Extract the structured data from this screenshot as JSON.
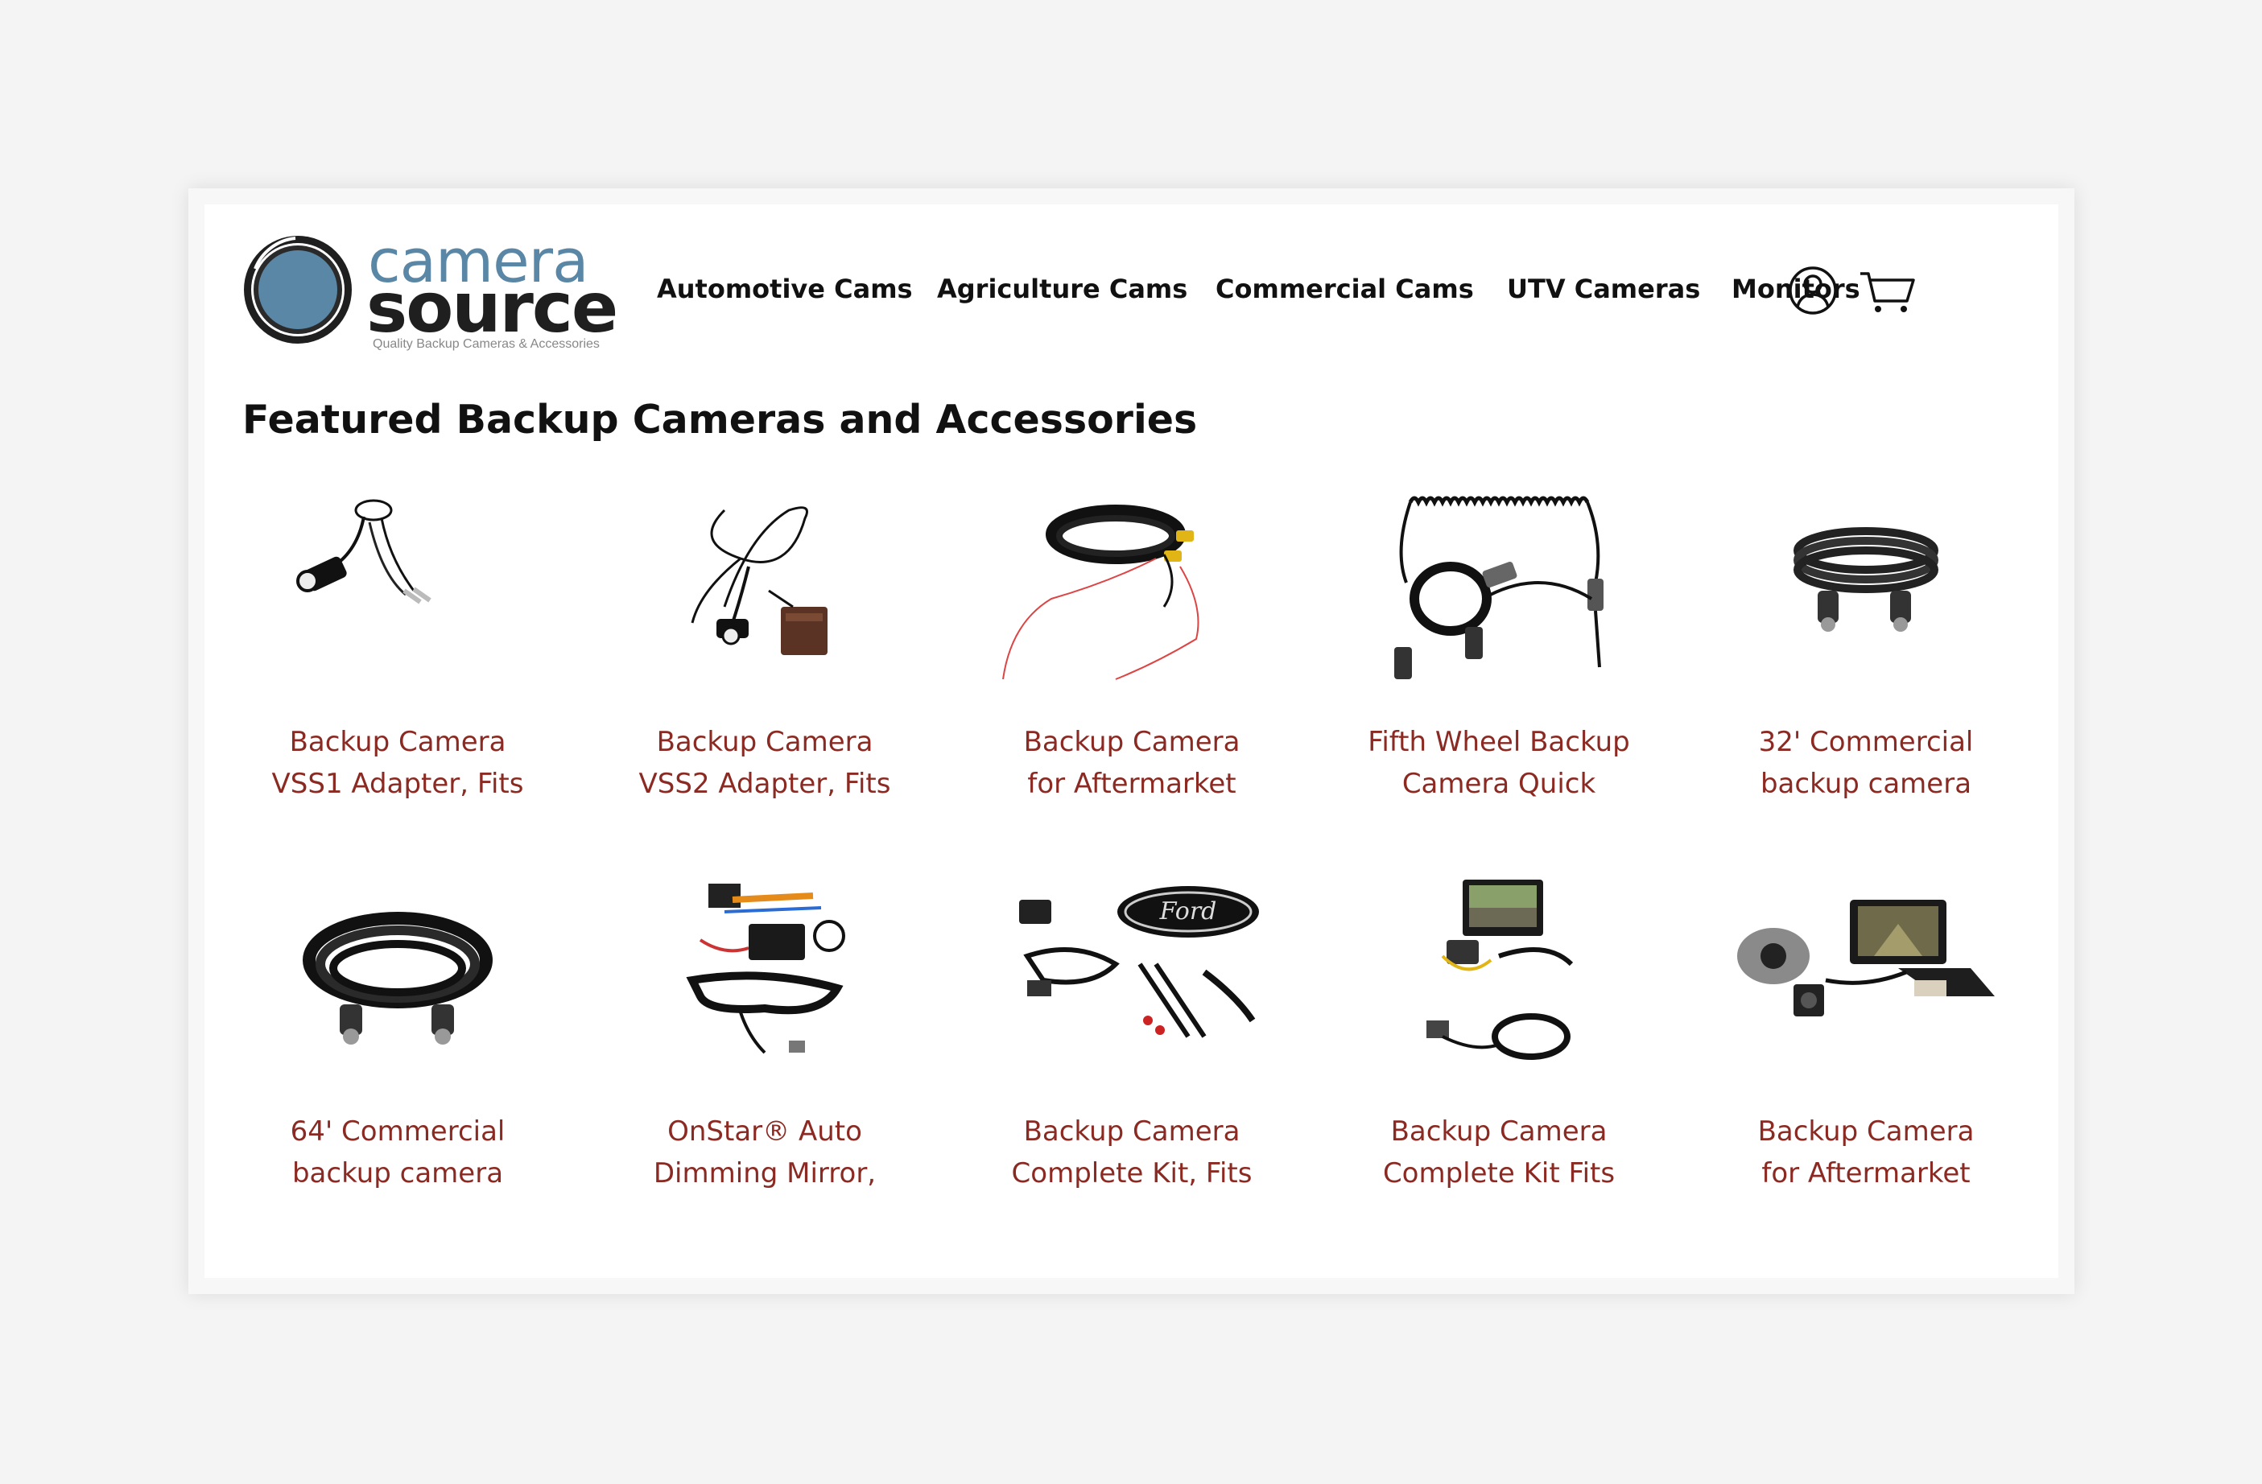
{
  "brand": {
    "name_top": "camera",
    "name_bottom": "source",
    "tagline": "Quality Backup Cameras & Accessories",
    "color_primary": "#5a87a6",
    "color_dark": "#1f1f1f"
  },
  "nav": {
    "items": [
      {
        "label": "Automotive Cams"
      },
      {
        "label": "Agriculture Cams"
      },
      {
        "label": "Commercial Cams"
      },
      {
        "label": "UTV Cameras"
      },
      {
        "label": "Monitors"
      }
    ],
    "account_icon": "user-circle-icon",
    "cart_icon": "shopping-cart-icon"
  },
  "main": {
    "heading": "Featured Backup Cameras and Accessories",
    "products": [
      {
        "title_line1": "Backup Camera",
        "title_line2": "VSS1 Adapter, Fits",
        "image": "adapter-cable"
      },
      {
        "title_line1": "Backup Camera",
        "title_line2": "VSS2 Adapter, Fits",
        "image": "adapter-cable-plug"
      },
      {
        "title_line1": "Backup Camera",
        "title_line2": "for Aftermarket",
        "image": "rca-cable-coil"
      },
      {
        "title_line1": "Fifth Wheel Backup",
        "title_line2": "Camera Quick",
        "image": "coiled-cable"
      },
      {
        "title_line1": "32' Commercial",
        "title_line2": "backup camera",
        "image": "cable-coil-small"
      },
      {
        "title_line1": "64' Commercial",
        "title_line2": "backup camera",
        "image": "cable-coil-large"
      },
      {
        "title_line1": "OnStar® Auto",
        "title_line2": "Dimming Mirror,",
        "image": "wiring-harness-kit"
      },
      {
        "title_line1": "Backup Camera",
        "title_line2": "Complete Kit, Fits",
        "image": "ford-emblem-kit"
      },
      {
        "title_line1": "Backup Camera",
        "title_line2": "Complete Kit Fits",
        "image": "monitor-kit"
      },
      {
        "title_line1": "Backup Camera",
        "title_line2": "for Aftermarket",
        "image": "camera-monitor-kit"
      }
    ]
  },
  "colors": {
    "product_title": "#8b2a22",
    "heading": "#111111"
  }
}
